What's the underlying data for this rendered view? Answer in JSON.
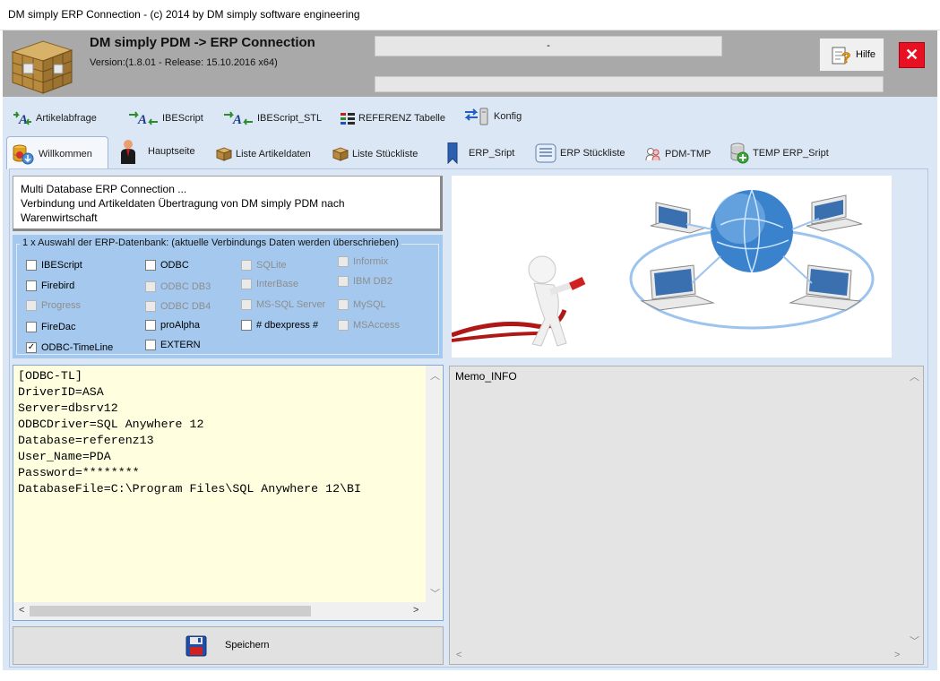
{
  "window": {
    "title": "DM simply ERP Connection - (c) 2014 by DM simply software engineering"
  },
  "header": {
    "app_name": "DM simply PDM  -> ERP Connection",
    "version": "Version:(1.8.01 - Release: 15.10.2016 x64)",
    "status_text": "-",
    "help_label": "Hilfe",
    "close_label": "✕"
  },
  "toolbar": {
    "items": [
      {
        "label": "Artikelabfrage",
        "icon": "arrows-a-icon"
      },
      {
        "label": "IBEScript",
        "icon": "arrows-a-icon"
      },
      {
        "label": "IBEScript_STL",
        "icon": "arrows-a-icon"
      },
      {
        "label": "REFERENZ Tabelle",
        "icon": "table-icon"
      },
      {
        "label": "Konfig",
        "icon": "config-icon"
      }
    ]
  },
  "tabs": {
    "items": [
      {
        "label": "Willkommen",
        "active": true
      },
      {
        "label": "Hauptseite"
      },
      {
        "label": "Liste Artikeldaten"
      },
      {
        "label": "Liste Stückliste"
      },
      {
        "label": "ERP_Sript"
      },
      {
        "label": "ERP Stückliste"
      },
      {
        "label": "PDM-TMP"
      },
      {
        "label": "TEMP ERP_Sript"
      }
    ]
  },
  "welcome": {
    "line1": "Multi Database ERP Connection ...",
    "line2": "Verbindung und Artikeldaten Übertragung von DM simply PDM nach",
    "line3": "Warenwirtschaft"
  },
  "db_group": {
    "caption": "1 x Auswahl der ERP-Datenbank: (aktuelle Verbindungs Daten werden überschrieben)",
    "options": [
      {
        "label": "IBEScript",
        "checked": false,
        "enabled": true
      },
      {
        "label": "Firebird",
        "checked": false,
        "enabled": true
      },
      {
        "label": "Progress",
        "checked": false,
        "enabled": false
      },
      {
        "label": "FireDac",
        "checked": false,
        "enabled": true
      },
      {
        "label": "ODBC-TimeLine",
        "checked": true,
        "enabled": true
      },
      {
        "label": "ODBC",
        "checked": false,
        "enabled": true
      },
      {
        "label": "ODBC DB3",
        "checked": false,
        "enabled": false
      },
      {
        "label": "ODBC DB4",
        "checked": false,
        "enabled": false
      },
      {
        "label": "proAlpha",
        "checked": false,
        "enabled": true
      },
      {
        "label": "EXTERN",
        "checked": false,
        "enabled": true
      },
      {
        "label": "SQLite",
        "checked": false,
        "enabled": false
      },
      {
        "label": "InterBase",
        "checked": false,
        "enabled": false
      },
      {
        "label": "MS-SQL Server",
        "checked": false,
        "enabled": false
      },
      {
        "label": "# dbexpress #",
        "checked": false,
        "enabled": true
      },
      {
        "label": "Informix",
        "checked": false,
        "enabled": false
      },
      {
        "label": "IBM DB2",
        "checked": false,
        "enabled": false
      },
      {
        "label": "MySQL",
        "checked": false,
        "enabled": false
      },
      {
        "label": "MSAccess",
        "checked": false,
        "enabled": false
      }
    ]
  },
  "memo": {
    "text": "[ODBC-TL]\nDriverID=ASA\nServer=dbsrv12\nODBCDriver=SQL Anywhere 12\nDatabase=referenz13\nUser_Name=PDA\nPassword=********\nDatabaseFile=C:\\Program Files\\SQL Anywhere 12\\BI"
  },
  "save_label": "Speichern",
  "info": {
    "label": "Memo_INFO"
  },
  "colors": {
    "accent_close": "#e81123",
    "header_gray": "#a9a9a9",
    "panel_blue": "#dce7f5",
    "group_blue": "#a4c8ee",
    "memo_yellow": "#ffffe0"
  }
}
